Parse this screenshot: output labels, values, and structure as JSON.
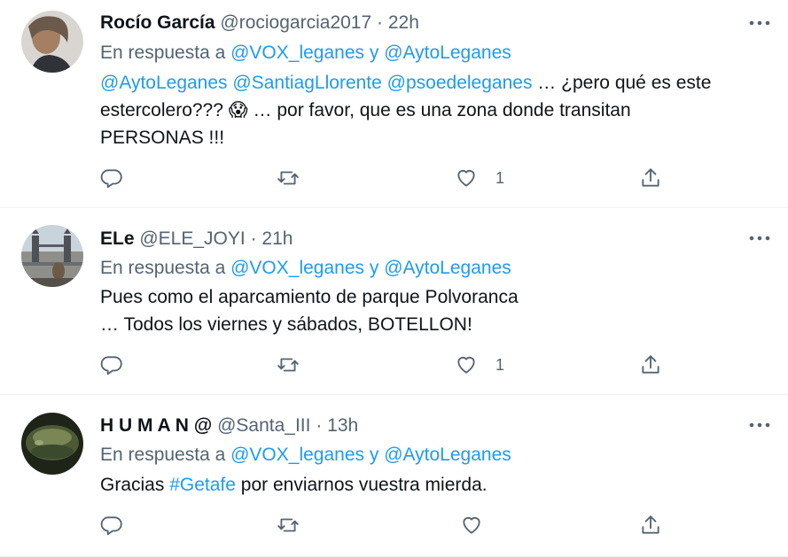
{
  "tweets": [
    {
      "name": "Rocío García",
      "handle": "@rociogarcia2017",
      "dot": "·",
      "time": "22h",
      "reply_prefix": "En respuesta a",
      "reply_m1": "@VOX_leganes",
      "reply_and": "y",
      "reply_m2": "@AytoLeganes",
      "body": {
        "m1": "@AytoLeganes",
        "m2": "@SantiagLlorente",
        "m3": "@psoedeleganes",
        "t1": "… ¿pero qué es este",
        "t2": "estercolero???",
        "emoji": "😱",
        "t3": "… por favor, que es una zona donde transitan",
        "t4": "PERSONAS  !!!"
      },
      "like_count": "1"
    },
    {
      "name": "ELe",
      "handle": "@ELE_JOYI",
      "dot": "·",
      "time": "21h",
      "reply_prefix": "En respuesta a",
      "reply_m1": "@VOX_leganes",
      "reply_and": "y",
      "reply_m2": "@AytoLeganes",
      "body": {
        "l1": "Pues como el aparcamiento de parque Polvoranca",
        "l2": "… Todos los viernes y sábados, BOTELLON!"
      },
      "like_count": "1"
    },
    {
      "name": "H U M A N @",
      "handle": "@Santa_III",
      "dot": "·",
      "time": "13h",
      "reply_prefix": "En respuesta a",
      "reply_m1": "@VOX_leganes",
      "reply_and": "y",
      "reply_m2": "@AytoLeganes",
      "body": {
        "t1": "Gracias",
        "tag": "#Getafe",
        "t2": "por enviarnos vuestra mierda."
      },
      "like_count": ""
    }
  ],
  "icons": {
    "more": "more-horizontal-icon",
    "reply": "reply-bubble-icon",
    "retweet": "retweet-icon",
    "like": "heart-icon",
    "share": "share-icon"
  },
  "colors": {
    "link": "#1d9bf0",
    "secondary": "#536471",
    "text": "#0f1419",
    "divider": "#eff3f4"
  }
}
